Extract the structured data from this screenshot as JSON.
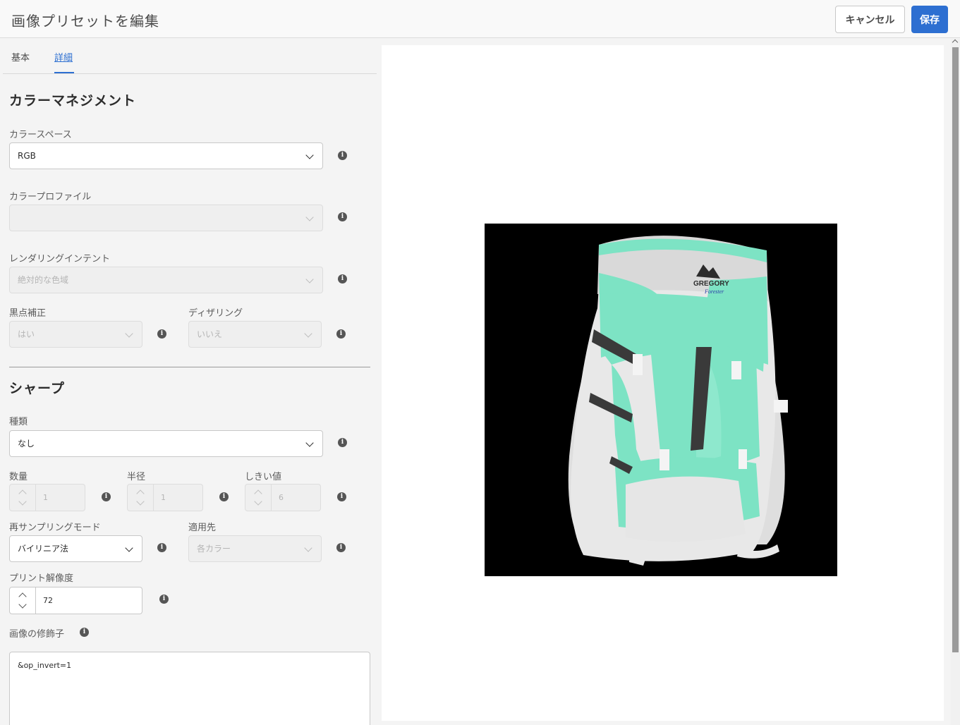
{
  "header": {
    "title": "画像プリセットを編集",
    "cancel_label": "キャンセル",
    "save_label": "保存"
  },
  "tabs": [
    {
      "label": "基本",
      "active": false
    },
    {
      "label": "詳細",
      "active": true
    }
  ],
  "color_management": {
    "heading": "カラーマネジメント",
    "color_space": {
      "label": "カラースペース",
      "value": "RGB"
    },
    "color_profile": {
      "label": "カラープロファイル",
      "value": ""
    },
    "rendering_intent": {
      "label": "レンダリングインテント",
      "value": "絶対的な色域"
    },
    "black_point": {
      "label": "黒点補正",
      "value": "はい"
    },
    "dithering": {
      "label": "ディザリング",
      "value": "いいえ"
    }
  },
  "sharpen": {
    "heading": "シャープ",
    "type": {
      "label": "種類",
      "value": "なし"
    },
    "amount": {
      "label": "数量",
      "value": "1"
    },
    "radius": {
      "label": "半径",
      "value": "1"
    },
    "threshold": {
      "label": "しきい値",
      "value": "6"
    },
    "resampling": {
      "label": "再サンプリングモード",
      "value": "バイリニア法"
    },
    "apply_to": {
      "label": "適用先",
      "value": "各カラー"
    },
    "print_resolution": {
      "label": "プリント解像度",
      "value": "72"
    },
    "image_modifier": {
      "label": "画像の修飾子",
      "value": "&op_invert=1"
    }
  },
  "info_glyph": "i",
  "preview": {
    "logo_text": "GREGORY",
    "logo_subtext": "Forester",
    "colors": {
      "background": "#000000",
      "accent": "#7de3c4",
      "body": "#e6e6e6",
      "brand": "#2d6fd1"
    }
  }
}
